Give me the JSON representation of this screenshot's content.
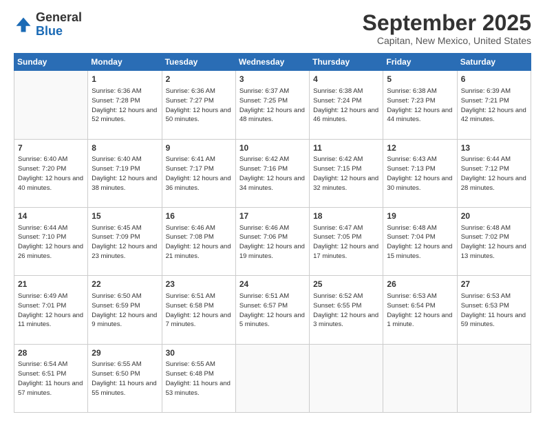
{
  "logo": {
    "general": "General",
    "blue": "Blue"
  },
  "header": {
    "month": "September 2025",
    "location": "Capitan, New Mexico, United States"
  },
  "days_of_week": [
    "Sunday",
    "Monday",
    "Tuesday",
    "Wednesday",
    "Thursday",
    "Friday",
    "Saturday"
  ],
  "weeks": [
    [
      {
        "day": "",
        "sunrise": "",
        "sunset": "",
        "daylight": ""
      },
      {
        "day": "1",
        "sunrise": "Sunrise: 6:36 AM",
        "sunset": "Sunset: 7:28 PM",
        "daylight": "Daylight: 12 hours and 52 minutes."
      },
      {
        "day": "2",
        "sunrise": "Sunrise: 6:36 AM",
        "sunset": "Sunset: 7:27 PM",
        "daylight": "Daylight: 12 hours and 50 minutes."
      },
      {
        "day": "3",
        "sunrise": "Sunrise: 6:37 AM",
        "sunset": "Sunset: 7:25 PM",
        "daylight": "Daylight: 12 hours and 48 minutes."
      },
      {
        "day": "4",
        "sunrise": "Sunrise: 6:38 AM",
        "sunset": "Sunset: 7:24 PM",
        "daylight": "Daylight: 12 hours and 46 minutes."
      },
      {
        "day": "5",
        "sunrise": "Sunrise: 6:38 AM",
        "sunset": "Sunset: 7:23 PM",
        "daylight": "Daylight: 12 hours and 44 minutes."
      },
      {
        "day": "6",
        "sunrise": "Sunrise: 6:39 AM",
        "sunset": "Sunset: 7:21 PM",
        "daylight": "Daylight: 12 hours and 42 minutes."
      }
    ],
    [
      {
        "day": "7",
        "sunrise": "Sunrise: 6:40 AM",
        "sunset": "Sunset: 7:20 PM",
        "daylight": "Daylight: 12 hours and 40 minutes."
      },
      {
        "day": "8",
        "sunrise": "Sunrise: 6:40 AM",
        "sunset": "Sunset: 7:19 PM",
        "daylight": "Daylight: 12 hours and 38 minutes."
      },
      {
        "day": "9",
        "sunrise": "Sunrise: 6:41 AM",
        "sunset": "Sunset: 7:17 PM",
        "daylight": "Daylight: 12 hours and 36 minutes."
      },
      {
        "day": "10",
        "sunrise": "Sunrise: 6:42 AM",
        "sunset": "Sunset: 7:16 PM",
        "daylight": "Daylight: 12 hours and 34 minutes."
      },
      {
        "day": "11",
        "sunrise": "Sunrise: 6:42 AM",
        "sunset": "Sunset: 7:15 PM",
        "daylight": "Daylight: 12 hours and 32 minutes."
      },
      {
        "day": "12",
        "sunrise": "Sunrise: 6:43 AM",
        "sunset": "Sunset: 7:13 PM",
        "daylight": "Daylight: 12 hours and 30 minutes."
      },
      {
        "day": "13",
        "sunrise": "Sunrise: 6:44 AM",
        "sunset": "Sunset: 7:12 PM",
        "daylight": "Daylight: 12 hours and 28 minutes."
      }
    ],
    [
      {
        "day": "14",
        "sunrise": "Sunrise: 6:44 AM",
        "sunset": "Sunset: 7:10 PM",
        "daylight": "Daylight: 12 hours and 26 minutes."
      },
      {
        "day": "15",
        "sunrise": "Sunrise: 6:45 AM",
        "sunset": "Sunset: 7:09 PM",
        "daylight": "Daylight: 12 hours and 23 minutes."
      },
      {
        "day": "16",
        "sunrise": "Sunrise: 6:46 AM",
        "sunset": "Sunset: 7:08 PM",
        "daylight": "Daylight: 12 hours and 21 minutes."
      },
      {
        "day": "17",
        "sunrise": "Sunrise: 6:46 AM",
        "sunset": "Sunset: 7:06 PM",
        "daylight": "Daylight: 12 hours and 19 minutes."
      },
      {
        "day": "18",
        "sunrise": "Sunrise: 6:47 AM",
        "sunset": "Sunset: 7:05 PM",
        "daylight": "Daylight: 12 hours and 17 minutes."
      },
      {
        "day": "19",
        "sunrise": "Sunrise: 6:48 AM",
        "sunset": "Sunset: 7:04 PM",
        "daylight": "Daylight: 12 hours and 15 minutes."
      },
      {
        "day": "20",
        "sunrise": "Sunrise: 6:48 AM",
        "sunset": "Sunset: 7:02 PM",
        "daylight": "Daylight: 12 hours and 13 minutes."
      }
    ],
    [
      {
        "day": "21",
        "sunrise": "Sunrise: 6:49 AM",
        "sunset": "Sunset: 7:01 PM",
        "daylight": "Daylight: 12 hours and 11 minutes."
      },
      {
        "day": "22",
        "sunrise": "Sunrise: 6:50 AM",
        "sunset": "Sunset: 6:59 PM",
        "daylight": "Daylight: 12 hours and 9 minutes."
      },
      {
        "day": "23",
        "sunrise": "Sunrise: 6:51 AM",
        "sunset": "Sunset: 6:58 PM",
        "daylight": "Daylight: 12 hours and 7 minutes."
      },
      {
        "day": "24",
        "sunrise": "Sunrise: 6:51 AM",
        "sunset": "Sunset: 6:57 PM",
        "daylight": "Daylight: 12 hours and 5 minutes."
      },
      {
        "day": "25",
        "sunrise": "Sunrise: 6:52 AM",
        "sunset": "Sunset: 6:55 PM",
        "daylight": "Daylight: 12 hours and 3 minutes."
      },
      {
        "day": "26",
        "sunrise": "Sunrise: 6:53 AM",
        "sunset": "Sunset: 6:54 PM",
        "daylight": "Daylight: 12 hours and 1 minute."
      },
      {
        "day": "27",
        "sunrise": "Sunrise: 6:53 AM",
        "sunset": "Sunset: 6:53 PM",
        "daylight": "Daylight: 11 hours and 59 minutes."
      }
    ],
    [
      {
        "day": "28",
        "sunrise": "Sunrise: 6:54 AM",
        "sunset": "Sunset: 6:51 PM",
        "daylight": "Daylight: 11 hours and 57 minutes."
      },
      {
        "day": "29",
        "sunrise": "Sunrise: 6:55 AM",
        "sunset": "Sunset: 6:50 PM",
        "daylight": "Daylight: 11 hours and 55 minutes."
      },
      {
        "day": "30",
        "sunrise": "Sunrise: 6:55 AM",
        "sunset": "Sunset: 6:48 PM",
        "daylight": "Daylight: 11 hours and 53 minutes."
      },
      {
        "day": "",
        "sunrise": "",
        "sunset": "",
        "daylight": ""
      },
      {
        "day": "",
        "sunrise": "",
        "sunset": "",
        "daylight": ""
      },
      {
        "day": "",
        "sunrise": "",
        "sunset": "",
        "daylight": ""
      },
      {
        "day": "",
        "sunrise": "",
        "sunset": "",
        "daylight": ""
      }
    ]
  ]
}
